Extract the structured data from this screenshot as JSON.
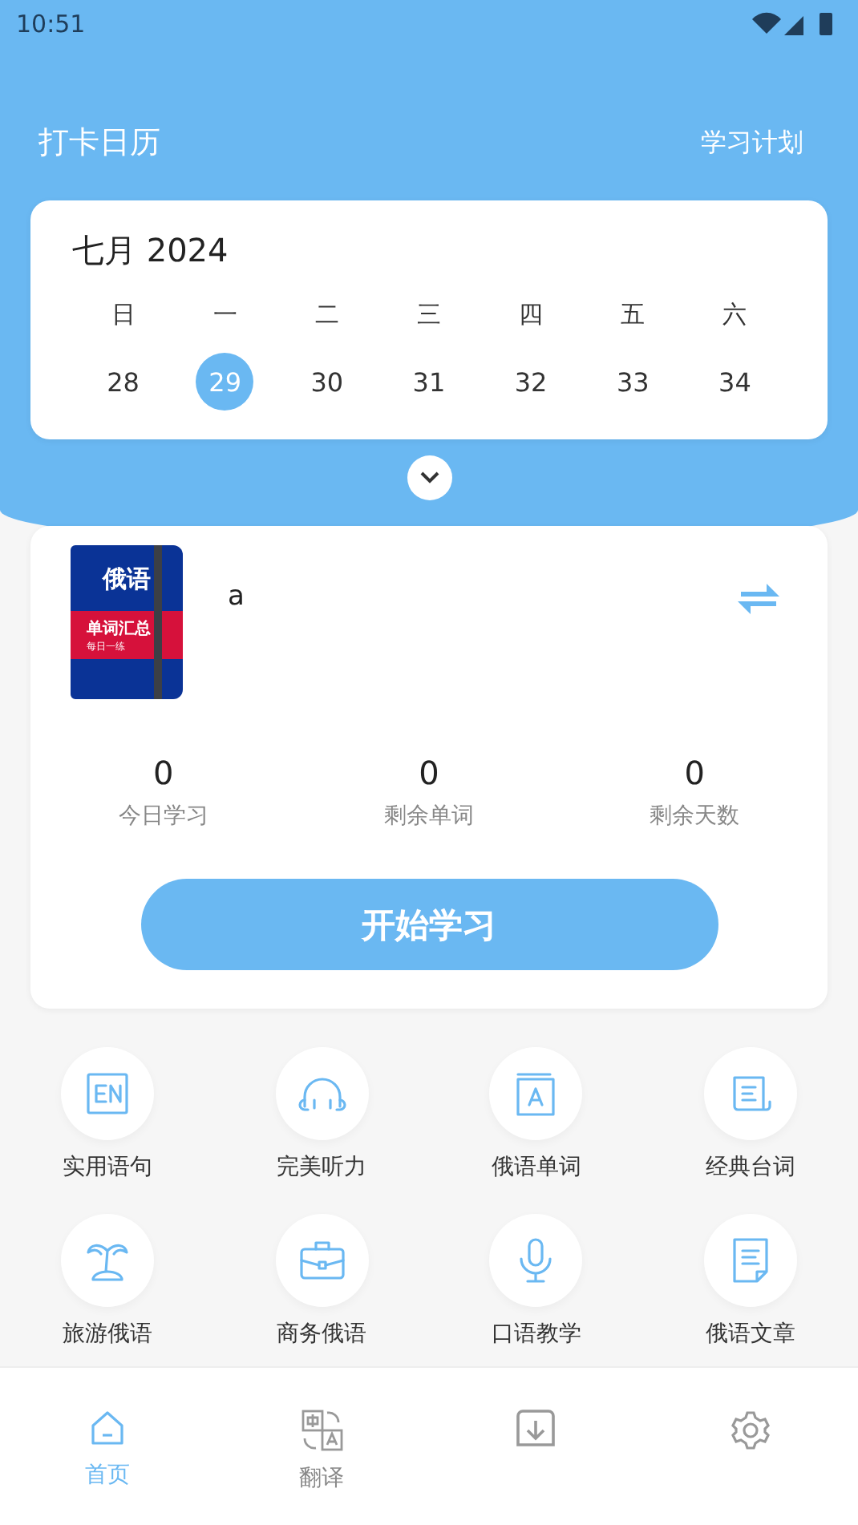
{
  "status_bar": {
    "time": "10:51"
  },
  "header": {
    "title": "打卡日历",
    "action": "学习计划"
  },
  "calendar": {
    "month": "七月 2024",
    "weekdays": [
      "日",
      "一",
      "二",
      "三",
      "四",
      "五",
      "六"
    ],
    "days": [
      {
        "label": "28",
        "selected": false
      },
      {
        "label": "29",
        "selected": true
      },
      {
        "label": "30",
        "selected": false
      },
      {
        "label": "31",
        "selected": false
      },
      {
        "label": "32",
        "selected": false
      },
      {
        "label": "33",
        "selected": false
      },
      {
        "label": "34",
        "selected": false
      }
    ],
    "expanded": false
  },
  "word_book": {
    "cover": {
      "title": "俄语",
      "band": "单词汇总",
      "subtitle": "每日一练"
    },
    "name": "a",
    "stats": [
      {
        "value": "0",
        "label": "今日学习"
      },
      {
        "value": "0",
        "label": "剩余单词"
      },
      {
        "value": "0",
        "label": "剩余天数"
      }
    ],
    "button": "开始学习"
  },
  "features": [
    {
      "kind": "en",
      "label": "实用语句"
    },
    {
      "kind": "headphones",
      "label": "完美听力"
    },
    {
      "kind": "book",
      "label": "俄语单词"
    },
    {
      "kind": "script",
      "label": "经典台词"
    },
    {
      "kind": "palm",
      "label": "旅游俄语"
    },
    {
      "kind": "briefcase",
      "label": "商务俄语"
    },
    {
      "kind": "mic",
      "label": "口语教学"
    },
    {
      "kind": "document",
      "label": "俄语文章"
    }
  ],
  "tab_bar": [
    {
      "kind": "home",
      "label": "首页",
      "selected": true
    },
    {
      "kind": "translate",
      "label": "翻译",
      "selected": false
    },
    {
      "kind": "download",
      "selected": false
    },
    {
      "kind": "gear",
      "selected": false
    }
  ]
}
